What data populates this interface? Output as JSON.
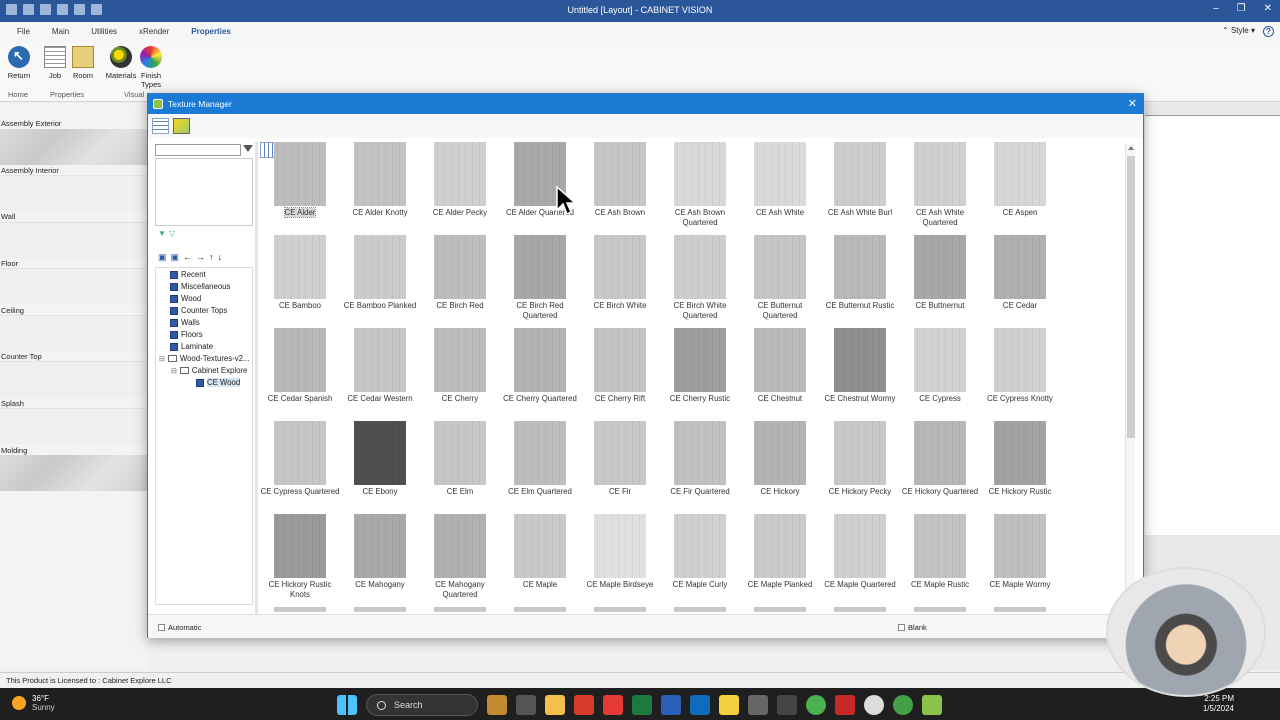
{
  "app": {
    "title": "Untitled [Layout] - CABINET VISION",
    "ribbon_tabs": [
      "File",
      "Main",
      "Utilities",
      "xRender",
      "Properties"
    ],
    "active_tab": "Properties",
    "style_label": "Style",
    "ribbon_buttons": {
      "return": "Return",
      "job": "Job",
      "room": "Room",
      "materials": "Materials",
      "finish_types": "Finish Types"
    },
    "ribbon_groups": {
      "home": "Home",
      "properties": "Properties",
      "visual": "Visual"
    }
  },
  "left_palette": {
    "categories": [
      "Assembly Exterior",
      "Assembly Interior",
      "Wall",
      "Floor",
      "Ceiling",
      "Counter Top",
      "Splash",
      "Molding"
    ]
  },
  "status_bar": {
    "license": "This Product is Licensed to : Cabinet Explore LLC"
  },
  "taskbar": {
    "temperature": "36°F",
    "condition": "Sunny",
    "search_label": "Search",
    "time": "2:25 PM",
    "date": "1/5/2024"
  },
  "dialog": {
    "title": "Texture Manager",
    "tree": [
      {
        "label": "Recent"
      },
      {
        "label": "Miscellaneous"
      },
      {
        "label": "Wood"
      },
      {
        "label": "Counter Tops"
      },
      {
        "label": "Walls"
      },
      {
        "label": "Floors"
      },
      {
        "label": "Laminate"
      },
      {
        "label": "Wood-Textures-v2..."
      },
      {
        "label": "Cabinet Explore"
      },
      {
        "label": "CE Wood"
      }
    ],
    "textures": [
      [
        "CE Alder",
        "#bdbdbd"
      ],
      [
        "CE Alder Knotty",
        "#c3c3c3"
      ],
      [
        "CE Alder Pecky",
        "#cfcfcf"
      ],
      [
        "CE Alder Quartered",
        "#a9a9a9"
      ],
      [
        "CE Ash Brown",
        "#c6c6c6"
      ],
      [
        "CE Ash Brown Quartered",
        "#d8d8d8"
      ],
      [
        "CE Ash White",
        "#dadada"
      ],
      [
        "CE Ash White Burl",
        "#cdcdcd"
      ],
      [
        "CE Ash White Quartered",
        "#d0d0d0"
      ],
      [
        "CE Aspen",
        "#d6d6d6"
      ],
      [
        "CE Bamboo",
        "#cfcfcf"
      ],
      [
        "CE Bamboo Planked",
        "#cbcbcb"
      ],
      [
        "CE Birch Red",
        "#bdbdbd"
      ],
      [
        "CE Birch Red Quartered",
        "#a8a8a8"
      ],
      [
        "CE Birch White",
        "#c8c8c8"
      ],
      [
        "CE Birch White Quartered",
        "#cdcdcd"
      ],
      [
        "CE Butternut Quartered",
        "#c5c5c5"
      ],
      [
        "CE Butternut Rustic",
        "#b9b9b9"
      ],
      [
        "CE Buttnernut",
        "#a8a8a8"
      ],
      [
        "CE Cedar",
        "#b0b0b0"
      ],
      [
        "CE Cedar Spanish",
        "#b8b8b8"
      ],
      [
        "CE Cedar Western",
        "#c6c6c6"
      ],
      [
        "CE Cherry",
        "#bcbcbc"
      ],
      [
        "CE Cherry Quartered",
        "#b4b4b4"
      ],
      [
        "CE Cherry Rift",
        "#c4c4c4"
      ],
      [
        "CE Cherry Rustic",
        "#9e9e9e"
      ],
      [
        "CE Chestnut",
        "#bababa"
      ],
      [
        "CE Chestnut Wormy",
        "#8f8f8f"
      ],
      [
        "CE Cypress",
        "#d2d2d2"
      ],
      [
        "CE Cypress Knotty",
        "#d0d0d0"
      ],
      [
        "CE Cypress Quartered",
        "#c6c6c6"
      ],
      [
        "CE Ebony",
        "#4f4f4f"
      ],
      [
        "CE Elm",
        "#c7c7c7"
      ],
      [
        "CE Elm Quartered",
        "#bdbdbd"
      ],
      [
        "CE Fir",
        "#c8c8c8"
      ],
      [
        "CE Fir Quartered",
        "#c1c1c1"
      ],
      [
        "CE Hickory",
        "#b4b4b4"
      ],
      [
        "CE Hickory Pecky",
        "#c8c8c8"
      ],
      [
        "CE Hickory Quartered",
        "#b7b7b7"
      ],
      [
        "CE Hickory Rustic",
        "#a3a3a3"
      ],
      [
        "CE Hickory Rustic Knots",
        "#9a9a9a"
      ],
      [
        "CE Mahogany",
        "#a9a9a9"
      ],
      [
        "CE Mahogany Quartered",
        "#b1b1b1"
      ],
      [
        "CE Maple",
        "#c9c9c9"
      ],
      [
        "CE Maple Birdseye",
        "#e0e0e0"
      ],
      [
        "CE Maple Curly",
        "#d0d0d0"
      ],
      [
        "CE Maple Planked",
        "#cacaca"
      ],
      [
        "CE Maple Quartered",
        "#cfcfcf"
      ],
      [
        "CE Maple Rustic",
        "#c3c3c3"
      ],
      [
        "CE Maple Wormy",
        "#c0c0c0"
      ]
    ],
    "selected_texture": "CE Alder",
    "automatic_label": "Automatic",
    "blank_label": "Blank"
  }
}
